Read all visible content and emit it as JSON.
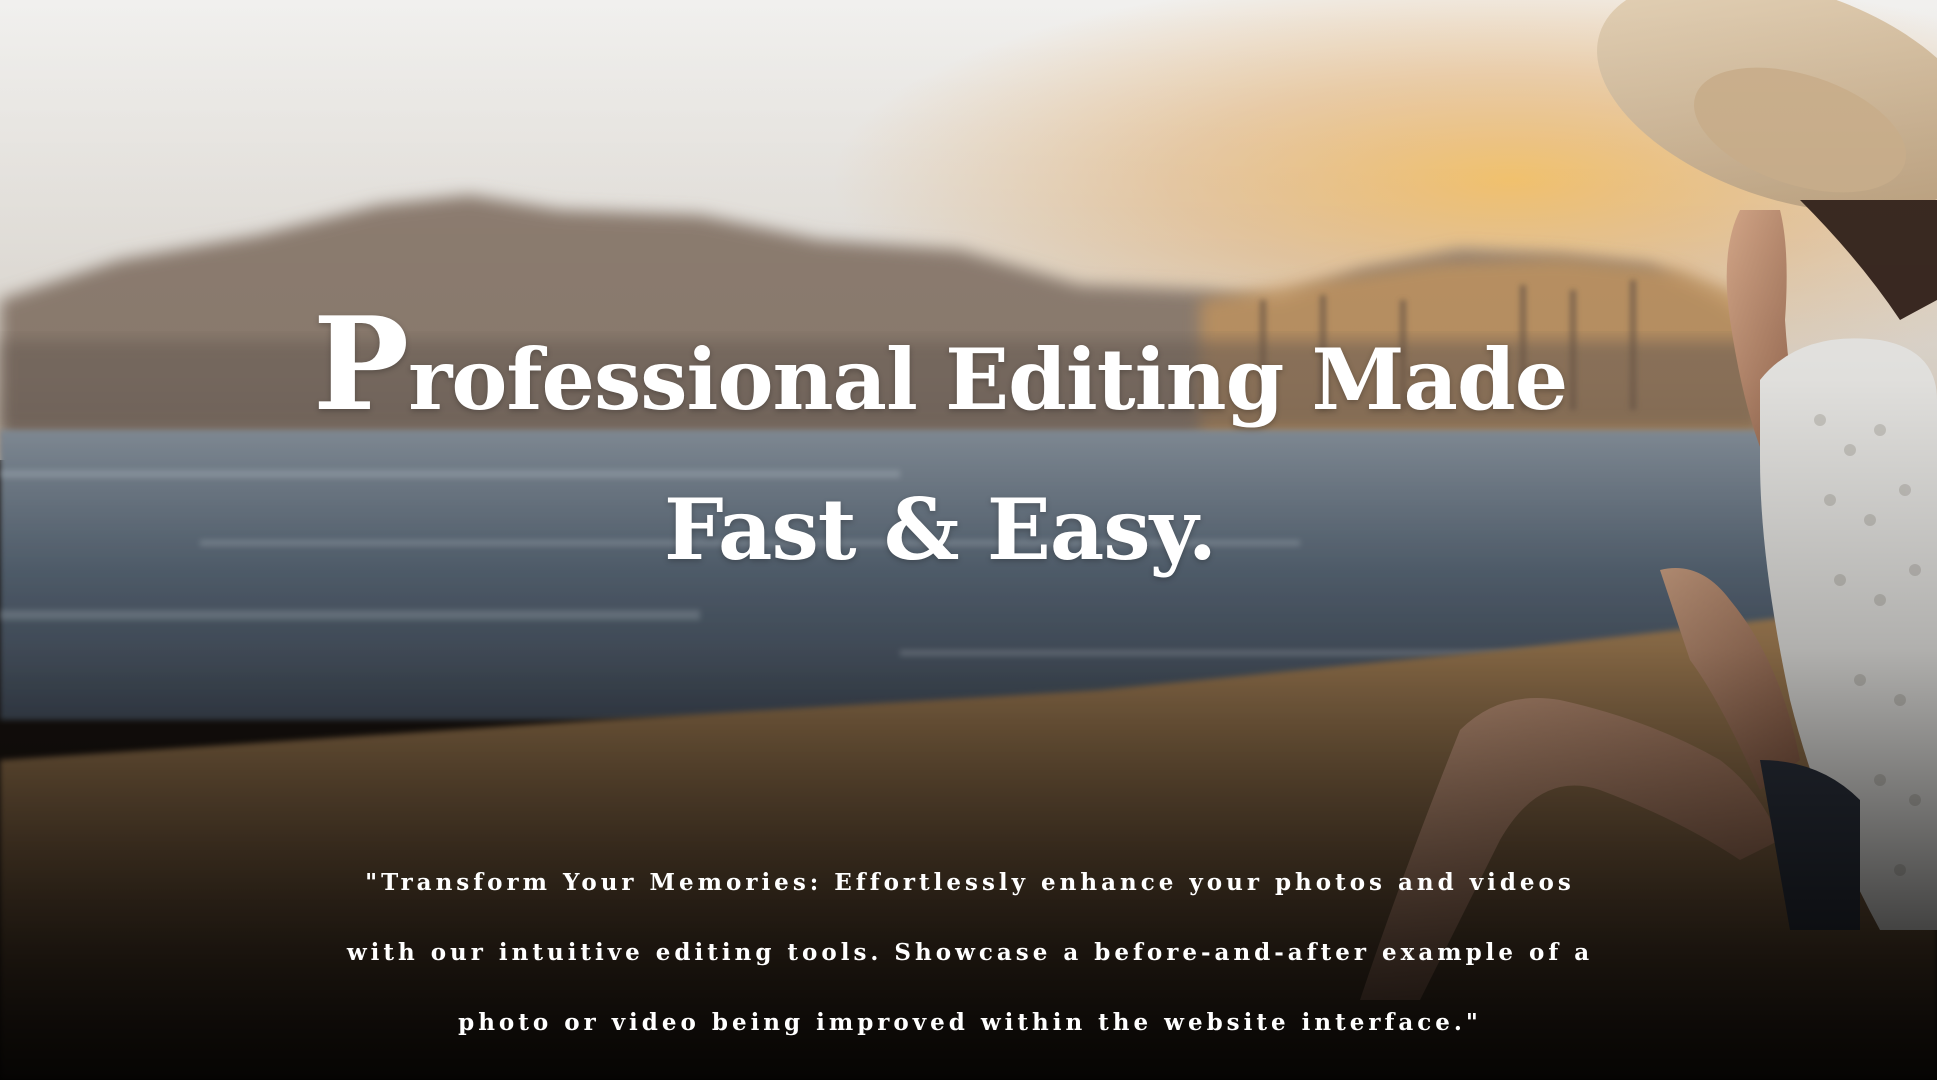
{
  "hero": {
    "headline_first_letter": "P",
    "headline_line1_rest": "rofessional Editing Made",
    "headline_line2": "Fast & Easy.",
    "tagline": "\"Transform Your Memories: Effortlessly enhance your photos and videos with our intuitive editing tools.  Showcase a before-and-after example of a photo or video being improved within the website interface.\""
  },
  "colors": {
    "text": "#ffffff",
    "sky": "#ecebe8",
    "mountain": "#8f7f72",
    "sea": "#6e7a86",
    "sand": "#b08a5c",
    "sunset_glow": "#f0b860"
  }
}
